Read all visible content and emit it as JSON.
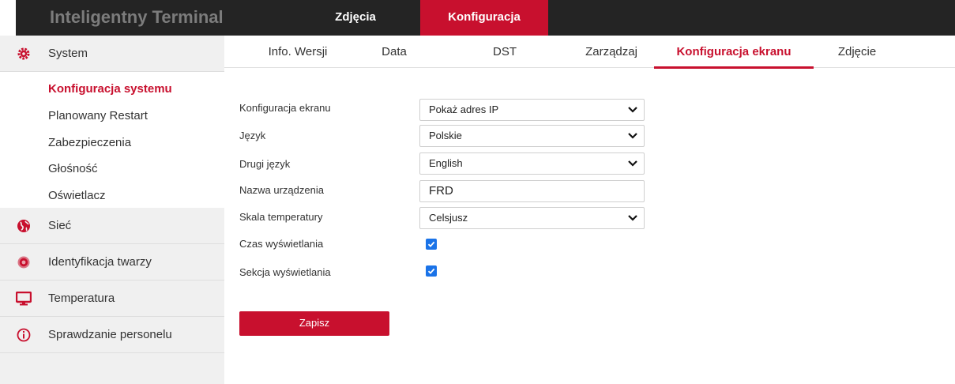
{
  "app": {
    "title": "Inteligentny Terminal",
    "top_tabs": [
      {
        "label": "Zdjęcia"
      },
      {
        "label": "Konfiguracja"
      }
    ],
    "active_top_tab": "Konfiguracja",
    "accent_color": "#c8102e"
  },
  "sidebar": {
    "groups": [
      {
        "label": "System",
        "icon": "gear-icon"
      },
      {
        "label": "Sieć",
        "icon": "globe-icon"
      },
      {
        "label": "Identyfikacja twarzy",
        "icon": "face-target-icon"
      },
      {
        "label": "Temperatura",
        "icon": "monitor-icon"
      },
      {
        "label": "Sprawdzanie personelu",
        "icon": "info-icon"
      }
    ],
    "system_items": [
      {
        "label": "Konfiguracja systemu"
      },
      {
        "label": "Planowany Restart"
      },
      {
        "label": "Zabezpieczenia"
      },
      {
        "label": "Głośność"
      },
      {
        "label": "Oświetlacz"
      }
    ],
    "active_item": "Konfiguracja systemu"
  },
  "subtabs": [
    {
      "label": "Info. Wersji"
    },
    {
      "label": "Data"
    },
    {
      "label": "DST"
    },
    {
      "label": "Zarządzaj"
    },
    {
      "label": "Konfiguracja ekranu"
    },
    {
      "label": "Zdjęcie"
    }
  ],
  "active_subtab": "Konfiguracja ekranu",
  "form": {
    "screen_config": {
      "label": "Konfiguracja ekranu",
      "value": "Pokaż adres IP"
    },
    "language": {
      "label": "Język",
      "value": "Polskie"
    },
    "second_language": {
      "label": "Drugi język",
      "value": "English"
    },
    "device_name": {
      "label": "Nazwa urządzenia",
      "value": "FRD"
    },
    "temperature_scale": {
      "label": "Skala temperatury",
      "value": "Celsjusz"
    },
    "display_time": {
      "label": "Czas wyświetlania",
      "checked": true
    },
    "display_section": {
      "label": "Sekcja wyświetlania",
      "checked": true
    },
    "save_label": "Zapisz"
  }
}
